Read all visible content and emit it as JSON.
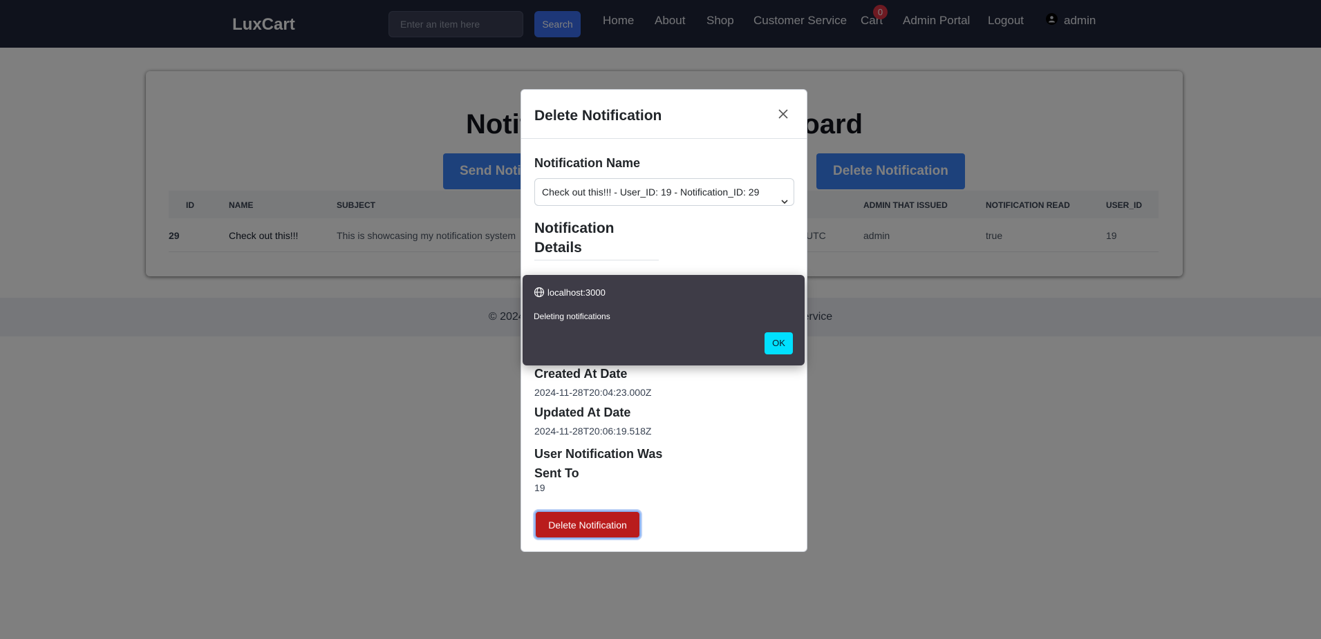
{
  "navbar": {
    "brand": "LuxCart",
    "search_placeholder": "Enter an item here",
    "search_button": "Search",
    "links": {
      "home": "Home",
      "about": "About",
      "shop": "Shop",
      "customer_service": "Customer Service",
      "cart": "Cart",
      "admin_portal": "Admin Portal",
      "logout": "Logout"
    },
    "cart_count": "0",
    "username": "admin"
  },
  "main": {
    "title": "Notification Admin Dashboard",
    "send_button": "Send Notification",
    "delete_button": "Delete Notification",
    "table": {
      "headers": {
        "id": "ID",
        "name": "NAME",
        "subject": "SUBJECT",
        "admin": "ADMIN THAT ISSUED",
        "read": "NOTIFICATION READ",
        "user_id": "USER_ID"
      },
      "rows": [
        {
          "id": "29",
          "name": "Check out this!!!",
          "subject": "This is showcasing my notification system",
          "date_tail": "UTC",
          "admin": "admin",
          "read": "true",
          "user_id": "19"
        }
      ]
    }
  },
  "footer": {
    "text": "© 2024 LuxCart. All rights reserved. | Privacy Policy | Terms of Service"
  },
  "modal": {
    "title": "Delete Notification",
    "name_label": "Notification Name",
    "select_value": "Check out this!!! - User_ID: 19 - Notification_ID: 29",
    "details_heading": "Notification Details",
    "created_label": "Created At Date",
    "created_value": "2024-11-28T20:04:23.000Z",
    "updated_label": "Updated At Date",
    "updated_value": "2024-11-28T20:06:19.518Z",
    "sent_to_label": "User Notification Was Sent To",
    "sent_to_value": "19",
    "delete_button": "Delete Notification"
  },
  "alert": {
    "origin": "localhost:3000",
    "message": "Deleting notifications",
    "ok_button": "OK"
  },
  "icons": {
    "close": "close-icon",
    "globe": "globe-icon",
    "user": "user-icon",
    "chevron": "chevron-down-icon"
  },
  "colors": {
    "navbar_bg": "#1f2438",
    "primary": "#3b82f6",
    "danger": "#b91c1c",
    "alert_bg": "#3e3c47",
    "alert_ok": "#00e0ff"
  }
}
